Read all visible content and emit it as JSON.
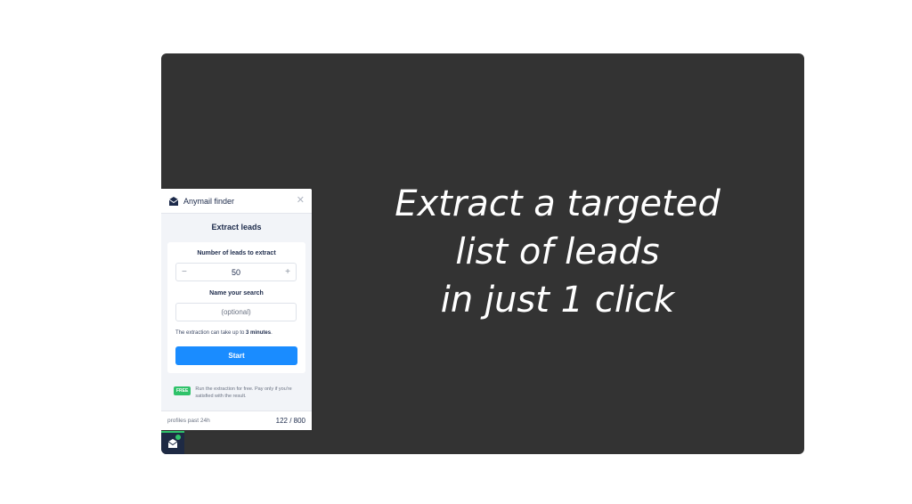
{
  "headline": {
    "line1": "Extract a targeted",
    "line2": "list of leads",
    "line3": "in just 1 click"
  },
  "popup": {
    "brand": "Anymail finder",
    "title": "Extract leads",
    "leads_label": "Number of leads to extract",
    "leads_value": "50",
    "decrement": "−",
    "increment": "+",
    "name_label": "Name your search",
    "name_placeholder": "(optional)",
    "note_prefix": "The extraction can take up to ",
    "note_bold": "3 minutes",
    "note_suffix": ".",
    "start_label": "Start",
    "free_badge": "FREE",
    "free_text": "Run the extraction for free. Pay only if you're satisfied with the result.",
    "footer_label": "profiles past 24h",
    "footer_count": "122 / 800"
  },
  "colors": {
    "stage_bg": "#333333",
    "accent_blue": "#1a8cff",
    "free_green": "#2fc26a",
    "navy": "#1c2a4a"
  },
  "icons": {
    "brand": "envelope-icon",
    "close": "close-icon",
    "launcher": "envelope-icon"
  }
}
